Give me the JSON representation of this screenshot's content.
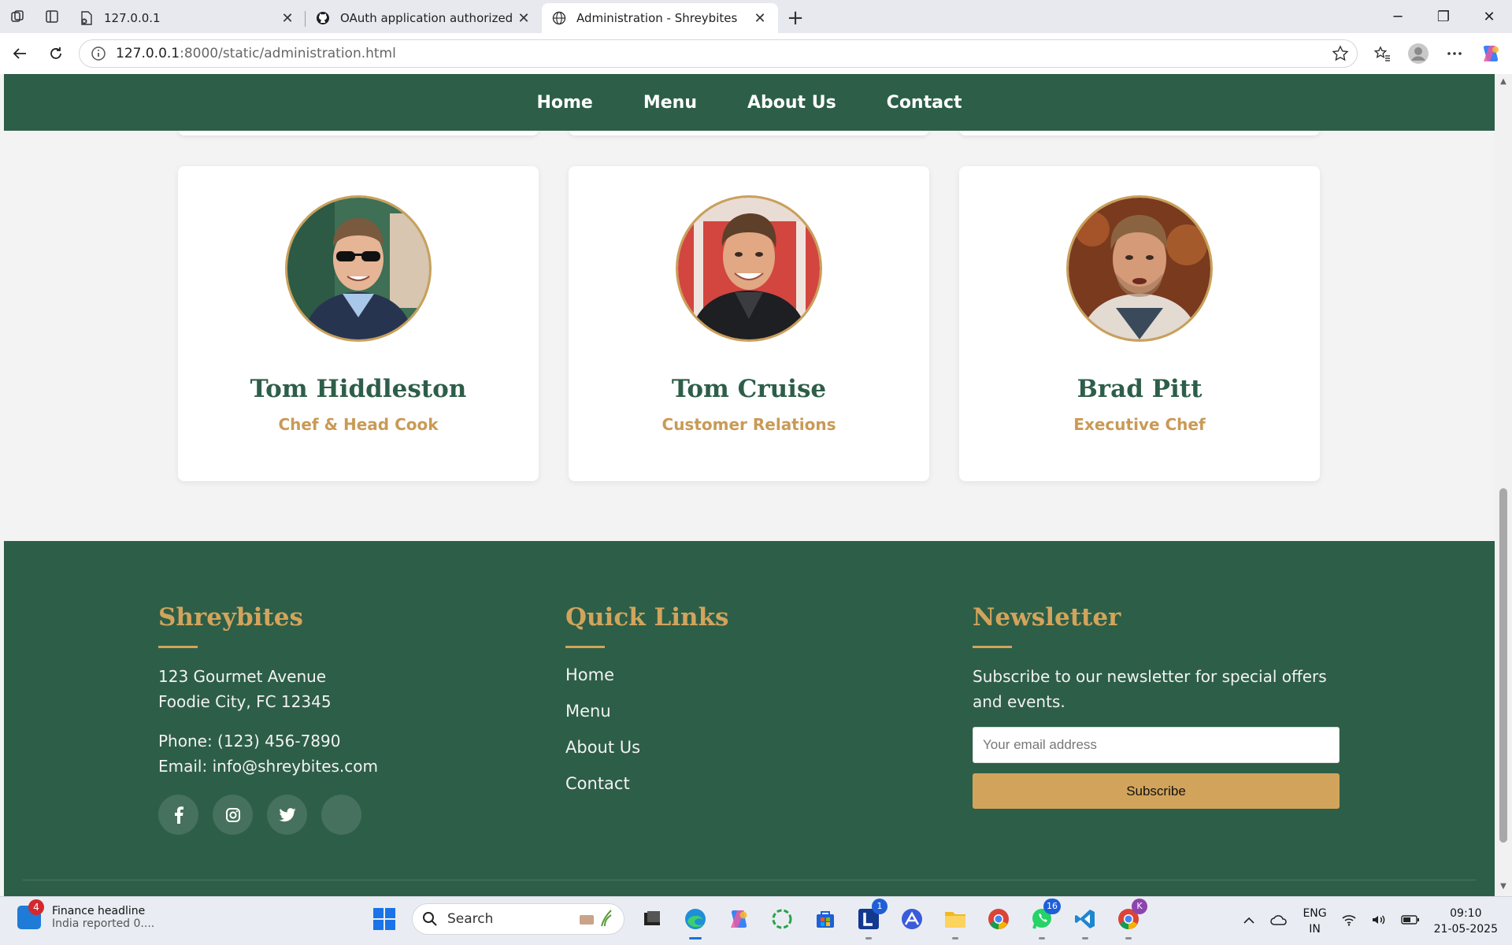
{
  "browser": {
    "tabs": [
      {
        "title": "127.0.0.1",
        "icon": "page-error-icon",
        "active": false
      },
      {
        "title": "OAuth application authorized",
        "icon": "github-icon",
        "active": false
      },
      {
        "title": "Administration - Shreybites",
        "icon": "globe-icon",
        "active": true
      }
    ],
    "new_tab_label": "+",
    "url_host": "127.0.0.1",
    "url_path": ":8000/static/administration.html"
  },
  "site": {
    "nav": [
      "Home",
      "Menu",
      "About Us",
      "Contact"
    ],
    "team": [
      {
        "name": "Tom Hiddleston",
        "role": "Chef & Head Cook"
      },
      {
        "name": "Tom Cruise",
        "role": "Customer Relations"
      },
      {
        "name": "Brad Pitt",
        "role": "Executive Chef"
      }
    ],
    "footer": {
      "brand": {
        "title": "Shreybites",
        "address_line1": "123 Gourmet Avenue",
        "address_line2": "Foodie City, FC 12345",
        "phone": "Phone: (123) 456-7890",
        "email": "Email: info@shreybites.com",
        "social": [
          "facebook-icon",
          "instagram-icon",
          "twitter-icon",
          "empty-social-icon"
        ]
      },
      "quick_links": {
        "title": "Quick Links",
        "links": [
          "Home",
          "Menu",
          "About Us",
          "Contact"
        ]
      },
      "newsletter": {
        "title": "Newsletter",
        "text": "Subscribe to our newsletter for special offers and events.",
        "placeholder": "Your email address",
        "button": "Subscribe"
      }
    }
  },
  "taskbar": {
    "news_badge": "4",
    "news_title": "Finance headline",
    "news_sub": "India reported 0....",
    "search_label": "Search",
    "apps": [
      {
        "icon": "file-explorer-dark-icon",
        "badge": "",
        "running": false
      },
      {
        "icon": "edge-icon",
        "badge": "",
        "running": true,
        "active": true
      },
      {
        "icon": "copilot-icon",
        "badge": "",
        "running": false
      },
      {
        "icon": "circle-app-icon",
        "badge": "",
        "running": false
      },
      {
        "icon": "store-icon",
        "badge": "",
        "running": false
      },
      {
        "icon": "l-app-icon",
        "badge": "1",
        "running": true
      },
      {
        "icon": "arc-app-icon",
        "badge": "",
        "running": false
      },
      {
        "icon": "folder-icon",
        "badge": "",
        "running": true
      },
      {
        "icon": "chrome-icon",
        "badge": "",
        "running": false
      },
      {
        "icon": "whatsapp-icon",
        "badge": "16",
        "running": true
      },
      {
        "icon": "vscode-icon",
        "badge": "",
        "running": true
      },
      {
        "icon": "chrome-profile-icon",
        "badge": "K",
        "running": true
      }
    ],
    "lang_line1": "ENG",
    "lang_line2": "IN",
    "time": "09:10",
    "date": "21-05-2025"
  },
  "colors": {
    "brand_green": "#2d5e48",
    "gold": "#d2a45b",
    "role_gold": "#c99a56"
  }
}
